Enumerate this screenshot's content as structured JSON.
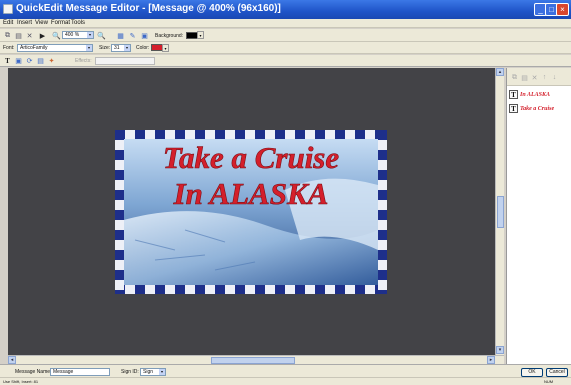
{
  "window": {
    "title": "QuickEdit Message Editor - [Message @ 400% (96x160)]"
  },
  "menu": [
    "Edit",
    "Insert",
    "View",
    "Format",
    "Tools"
  ],
  "toolbar": {
    "zoom": "400 %",
    "background_label": "Background:",
    "background_color": "#000000"
  },
  "format_bar": {
    "font_label": "Font:",
    "font_value": "ArticoFamily",
    "size_label": "Size:",
    "size_value": "31",
    "color_label": "Color:",
    "color_value": "#d41f2b",
    "effect_label": "Effects:"
  },
  "message": {
    "line1": "Take a Cruise",
    "line2": "In ALASKA",
    "text_color": "#d41f2b",
    "border_color": "#1e2f8a"
  },
  "layers": {
    "items": [
      {
        "label": "In ALASKA"
      },
      {
        "label": "Take a Cruise"
      }
    ]
  },
  "bottom": {
    "name_label": "Message Name:",
    "name_value": "Message",
    "sign_label": "Sign ID:",
    "sign_value": "Sign",
    "ok_label": "OK",
    "cancel_label": "Cancel"
  },
  "status": {
    "left": "Use Shift, Insert: 81",
    "right": "NUM"
  }
}
